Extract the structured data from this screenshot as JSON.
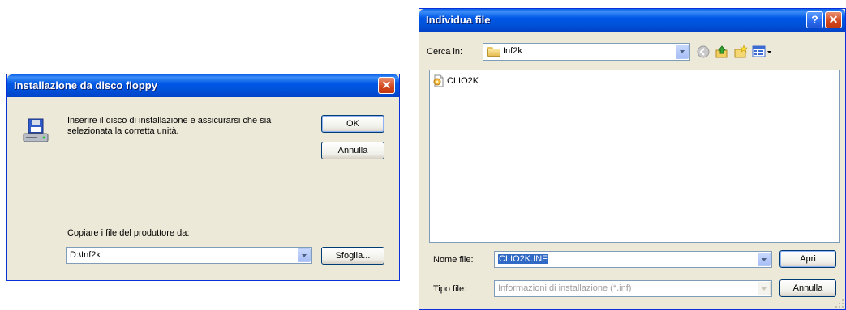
{
  "floppy_dialog": {
    "title": "Installazione da disco floppy",
    "message_line1": "Inserire il disco di installazione e assicurarsi che sia",
    "message_line2": "selezionata la corretta unità.",
    "ok_label": "OK",
    "cancel_label": "Annulla",
    "copy_label": "Copiare i file del produttore da:",
    "path_value": "D:\\Inf2k",
    "browse_label": "Sfoglia..."
  },
  "file_dialog": {
    "title": "Individua file",
    "look_in_label": "Cerca in:",
    "look_in_value": "Inf2k",
    "files": [
      {
        "name": "CLIO2K",
        "icon": "setup-information-icon"
      }
    ],
    "filename_label": "Nome file:",
    "filename_value": "CLIO2K.INF",
    "filetype_label": "Tipo file:",
    "filetype_value": "Informazioni di installazione (*.inf)",
    "open_label": "Apri",
    "cancel_label": "Annulla"
  },
  "colors": {
    "titlebar": "#0058e6",
    "dialog_face": "#ece9d8",
    "selection": "#316ac5"
  }
}
